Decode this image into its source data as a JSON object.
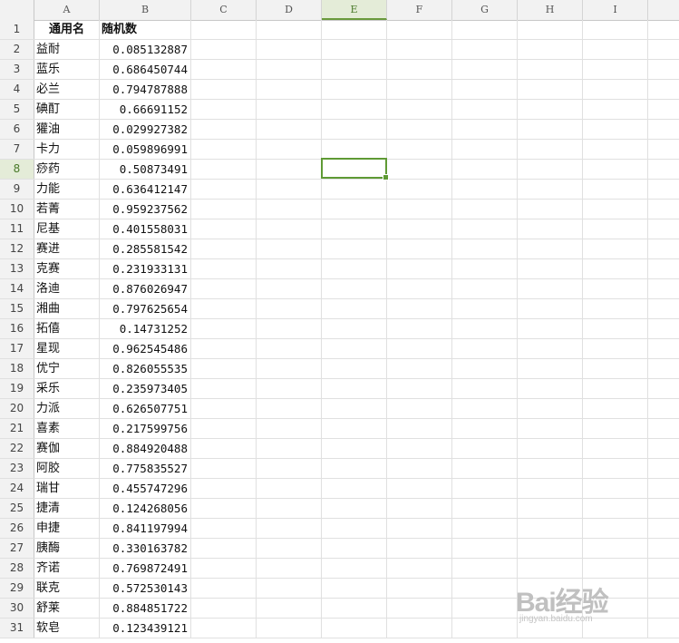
{
  "columns": [
    "A",
    "B",
    "C",
    "D",
    "E",
    "F",
    "G",
    "H",
    "I"
  ],
  "active_column": "E",
  "active_row": "8",
  "header_row": {
    "row": "1",
    "a": "通用名",
    "b": "随机数"
  },
  "rows": [
    {
      "n": "2",
      "a": "益耐",
      "b": "0.085132887"
    },
    {
      "n": "3",
      "a": "蓝乐",
      "b": "0.686450744"
    },
    {
      "n": "4",
      "a": "必兰",
      "b": "0.794787888"
    },
    {
      "n": "5",
      "a": "碘酊",
      "b": "0.66691152"
    },
    {
      "n": "6",
      "a": "獾油",
      "b": "0.029927382"
    },
    {
      "n": "7",
      "a": "卡力",
      "b": "0.059896991"
    },
    {
      "n": "8",
      "a": "痧药",
      "b": "0.50873491"
    },
    {
      "n": "9",
      "a": "力能",
      "b": "0.636412147"
    },
    {
      "n": "10",
      "a": "若菁",
      "b": "0.959237562"
    },
    {
      "n": "11",
      "a": "尼基",
      "b": "0.401558031"
    },
    {
      "n": "12",
      "a": "赛进",
      "b": "0.285581542"
    },
    {
      "n": "13",
      "a": "克赛",
      "b": "0.231933131"
    },
    {
      "n": "14",
      "a": "洛迪",
      "b": "0.876026947"
    },
    {
      "n": "15",
      "a": "湘曲",
      "b": "0.797625654"
    },
    {
      "n": "16",
      "a": "拓僖",
      "b": "0.14731252"
    },
    {
      "n": "17",
      "a": "星现",
      "b": "0.962545486"
    },
    {
      "n": "18",
      "a": "优宁",
      "b": "0.826055535"
    },
    {
      "n": "19",
      "a": "采乐",
      "b": "0.235973405"
    },
    {
      "n": "20",
      "a": "力派",
      "b": "0.626507751"
    },
    {
      "n": "21",
      "a": "喜素",
      "b": "0.217599756"
    },
    {
      "n": "22",
      "a": "赛伽",
      "b": "0.884920488"
    },
    {
      "n": "23",
      "a": "阿胶",
      "b": "0.775835527"
    },
    {
      "n": "24",
      "a": "瑞甘",
      "b": "0.455747296"
    },
    {
      "n": "25",
      "a": "捷清",
      "b": "0.124268056"
    },
    {
      "n": "26",
      "a": "申捷",
      "b": "0.841197994"
    },
    {
      "n": "27",
      "a": "胰酶",
      "b": "0.330163782"
    },
    {
      "n": "28",
      "a": "齐诺",
      "b": "0.769872491"
    },
    {
      "n": "29",
      "a": "联克",
      "b": "0.572530143"
    },
    {
      "n": "30",
      "a": "舒莱",
      "b": "0.884851722"
    },
    {
      "n": "31",
      "a": "软皂",
      "b": "0.123439121"
    }
  ],
  "watermark": {
    "logo": "Bai经验",
    "sub": "jingyan.baidu.com"
  }
}
